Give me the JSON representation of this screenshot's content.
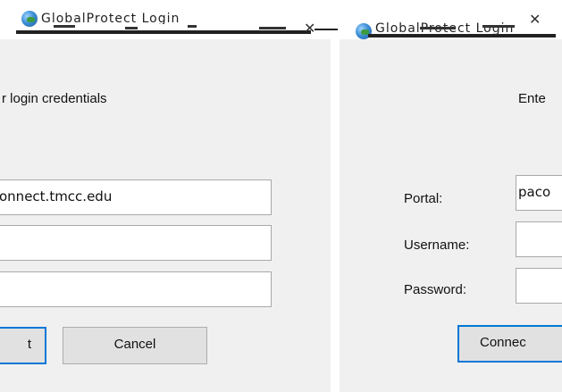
{
  "left_window": {
    "title": "GlobalProtect Login",
    "instruction": "r login credentials",
    "portal_value": "onnect.tmcc.edu",
    "username_value": "",
    "password_value": "",
    "connect_label": "t",
    "cancel_label": "Cancel"
  },
  "right_window": {
    "title": "GlobalProtect Login",
    "instruction": "Ente",
    "portal_label": "Portal:",
    "username_label": "Username:",
    "password_label": "Password:",
    "portal_value": "paco",
    "username_value": "",
    "password_value": "",
    "connect_label": "Connec"
  },
  "icons": {
    "left_app_icon": "globe-icon",
    "right_app_icon": "globe-icon",
    "close_icon": "close-icon"
  },
  "colors": {
    "panel_bg": "#f0f0f0",
    "input_border": "#a9a9a9",
    "button_bg": "#e1e1e1",
    "focus_accent": "#0078d7"
  }
}
